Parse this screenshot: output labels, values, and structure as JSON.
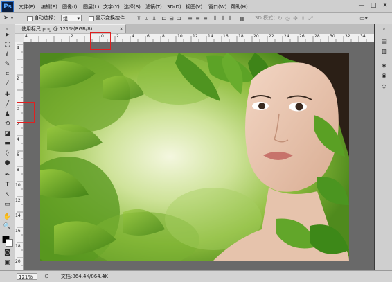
{
  "app": {
    "logo": "Ps"
  },
  "menu": [
    "文件(F)",
    "编辑(E)",
    "图像(I)",
    "图层(L)",
    "文字(Y)",
    "选择(S)",
    "滤镜(T)",
    "3D(D)",
    "视图(V)",
    "窗口(W)",
    "帮助(H)"
  ],
  "window_controls": {
    "minimize": "—",
    "maximize": "□",
    "close": "✕"
  },
  "options": {
    "auto_select_label": "自动选择：",
    "auto_select_value": "组",
    "show_transform_label": "显示变换控件",
    "mode_label": "3D 模式："
  },
  "document": {
    "tab_title": "使用标尺.png @ 121%(RGB/8)",
    "tab_close": "×"
  },
  "ruler": {
    "h_labels": [
      "4",
      "2",
      "0",
      "2",
      "4",
      "6",
      "8",
      "10",
      "12",
      "14",
      "16",
      "18",
      "20",
      "22",
      "24",
      "26",
      "28",
      "30",
      "32",
      "34",
      "36"
    ],
    "v_labels": [
      "4",
      "2",
      "0",
      "2",
      "4",
      "6",
      "8",
      "10",
      "12",
      "14",
      "16",
      "18",
      "20"
    ]
  },
  "status": {
    "zoom": "121%",
    "doc_info": "文档:864.4K/864.4K"
  },
  "colors": {
    "fg_swatch": "#000000",
    "bg_swatch": "#ffffff",
    "highlight": "#e02020"
  },
  "icons": {
    "tools": [
      "move-icon",
      "marquee-icon",
      "lasso-icon",
      "quick-select-icon",
      "crop-icon",
      "eyedropper-icon",
      "healing-icon",
      "brush-icon",
      "clone-stamp-icon",
      "history-brush-icon",
      "eraser-icon",
      "gradient-icon",
      "blur-icon",
      "dodge-icon",
      "pen-icon",
      "type-icon",
      "path-select-icon",
      "shape-icon",
      "hand-icon",
      "zoom-icon"
    ]
  }
}
